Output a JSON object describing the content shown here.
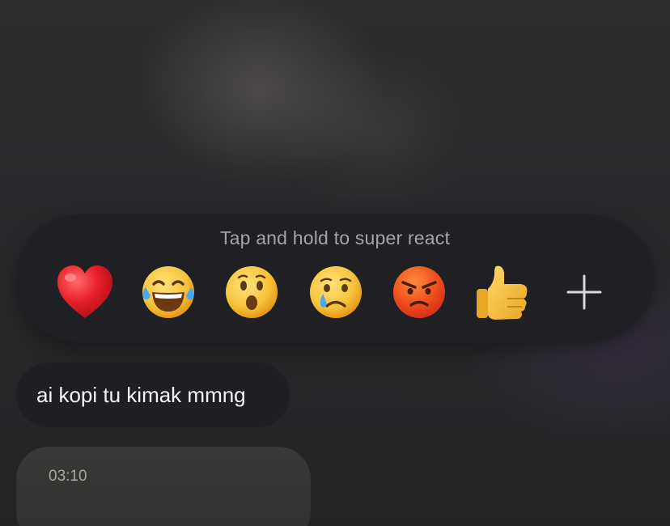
{
  "reaction_bar": {
    "hint": "Tap and hold to super react",
    "reactions": [
      {
        "icon": "red-heart-icon",
        "color": "#e01b24"
      },
      {
        "icon": "face-with-tears-of-joy-icon",
        "color": "#f7c23a"
      },
      {
        "icon": "face-with-open-mouth-icon",
        "color": "#f7c23a"
      },
      {
        "icon": "crying-face-icon",
        "color": "#f7c23a"
      },
      {
        "icon": "angry-face-icon",
        "color": "#f0521f"
      },
      {
        "icon": "thumbs-up-icon",
        "color": "#f5c340"
      },
      {
        "icon": "plus-icon",
        "color": "#d9d9dd"
      }
    ]
  },
  "messages": [
    {
      "type": "text",
      "text": "ai kopi tu kimak mmng"
    },
    {
      "type": "media",
      "duration": "03:10"
    }
  ]
}
